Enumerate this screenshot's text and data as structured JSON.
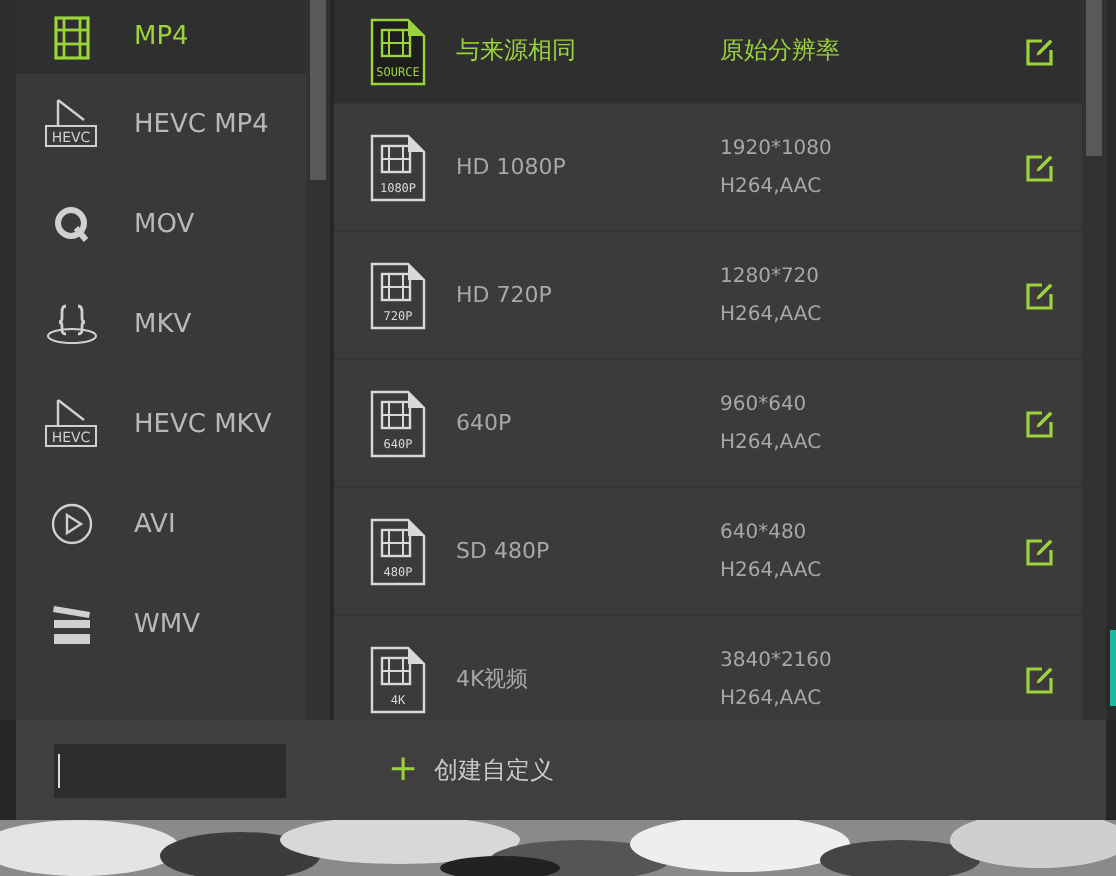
{
  "formats": [
    {
      "label": "MP4",
      "kind": "film",
      "selected": true
    },
    {
      "label": "HEVC MP4",
      "kind": "hevc",
      "badge": "HEVC",
      "selected": false
    },
    {
      "label": "MOV",
      "kind": "q",
      "selected": false
    },
    {
      "label": "MKV",
      "kind": "braces",
      "selected": false
    },
    {
      "label": "HEVC MKV",
      "kind": "hevc",
      "badge": "HEVC",
      "selected": false
    },
    {
      "label": "AVI",
      "kind": "play",
      "selected": false
    },
    {
      "label": "WMV",
      "kind": "clapper",
      "selected": false
    }
  ],
  "presets": [
    {
      "badge": "SOURCE",
      "name": "与来源相同",
      "resolution": "原始分辨率",
      "selected": true
    },
    {
      "badge": "1080P",
      "name": "HD 1080P",
      "resolution": "1920*1080",
      "codec": "H264,AAC",
      "selected": false
    },
    {
      "badge": "720P",
      "name": "HD 720P",
      "resolution": "1280*720",
      "codec": "H264,AAC",
      "selected": false
    },
    {
      "badge": "640P",
      "name": "640P",
      "resolution": "960*640",
      "codec": "H264,AAC",
      "selected": false
    },
    {
      "badge": "480P",
      "name": "SD 480P",
      "resolution": "640*480",
      "codec": "H264,AAC",
      "selected": false
    },
    {
      "badge": "4K",
      "name": "4K视频",
      "resolution": "3840*2160",
      "codec": "H264,AAC",
      "selected": false
    }
  ],
  "custom_button": {
    "icon": "+",
    "label": "创建自定义"
  }
}
